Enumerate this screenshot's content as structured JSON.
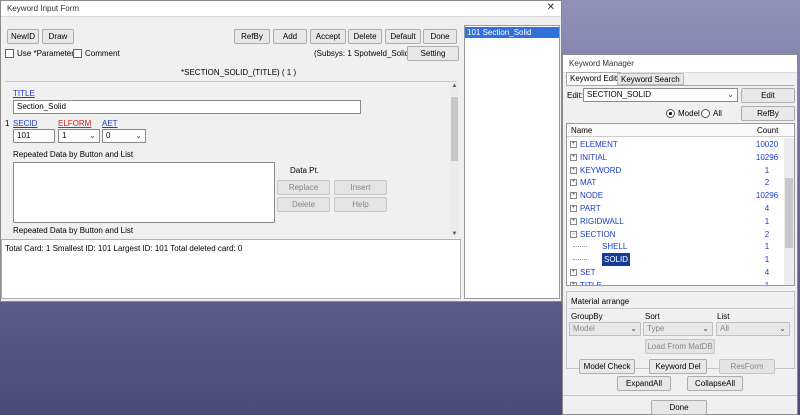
{
  "kif": {
    "title": "Keyword Input Form",
    "buttons": {
      "newid": "NewID",
      "draw": "Draw",
      "refby": "RefBy",
      "add": "Add",
      "accept": "Accept",
      "delete": "Delete",
      "default": "Default",
      "done": "Done",
      "setting": "Setting"
    },
    "use_param": "Use *Parameter",
    "comment": "Comment",
    "subsys": "(Subsys: 1 Spotweld_Solid.k)",
    "keyword_header": "*SECTION_SOLID_(TITLE)   ( 1 )",
    "title_label": "TITLE",
    "title_value": "Section_Solid",
    "row_num": "1",
    "secid_label": "SECID",
    "elform_label": "ELFORM",
    "aet_label": "AET",
    "secid_value": "101",
    "elform_value": "1",
    "aet_value": "0",
    "repeated_1": "Repeated Data by Button and List",
    "repeated_2": "Repeated Data by Button and List",
    "data_pt": "Data Pt.",
    "replace": "Replace",
    "insert": "Insert",
    "delete2": "Delete",
    "help": "Help",
    "status": "Total Card: 1    Smallest ID: 101    Largest ID: 101    Total deleted card:  0",
    "list_item": "101  Section_Solid"
  },
  "km": {
    "title": "Keyword Manager",
    "tabs": [
      "Keyword Edit",
      "Keyword Search"
    ],
    "edit_label": "Edit:",
    "edit_value": "SECTION_SOLID",
    "edit_button": "Edit",
    "radio_model": "Model",
    "radio_all": "All",
    "refby": "RefBy",
    "col_name": "Name",
    "col_count": "Count",
    "tree": [
      {
        "name": "ELEMENT",
        "count": "10020",
        "expander": "+",
        "indent": 0
      },
      {
        "name": "INITIAL",
        "count": "10296",
        "expander": "+",
        "indent": 0
      },
      {
        "name": "KEYWORD",
        "count": "1",
        "expander": "+",
        "indent": 0
      },
      {
        "name": "MAT",
        "count": "2",
        "expander": "+",
        "indent": 0
      },
      {
        "name": "NODE",
        "count": "10296",
        "expander": "+",
        "indent": 0
      },
      {
        "name": "PART",
        "count": "4",
        "expander": "+",
        "indent": 0
      },
      {
        "name": "RIGIDWALL",
        "count": "1",
        "expander": "+",
        "indent": 0
      },
      {
        "name": "SECTION",
        "count": "2",
        "expander": "-",
        "indent": 0
      },
      {
        "name": "SHELL",
        "count": "1",
        "expander": "",
        "indent": 1
      },
      {
        "name": "SOLID",
        "count": "1",
        "expander": "",
        "indent": 1
      },
      {
        "name": "SET",
        "count": "4",
        "expander": "+",
        "indent": 0
      },
      {
        "name": "TITLE",
        "count": "1",
        "expander": "+",
        "indent": 0
      }
    ],
    "material_arrange": "Material arrange",
    "groupby": "GroupBy",
    "sort": "Sort",
    "list": "List",
    "groupby_value": "Model",
    "sort_value": "Type",
    "list_value": "All",
    "load_matdb": "Load From MatDB",
    "model_check": "Model Check",
    "keyword_del": "Keyword Del",
    "resform": "ResForm",
    "expand_all": "ExpandAll",
    "collapse_all": "CollapseAll",
    "done": "Done"
  }
}
